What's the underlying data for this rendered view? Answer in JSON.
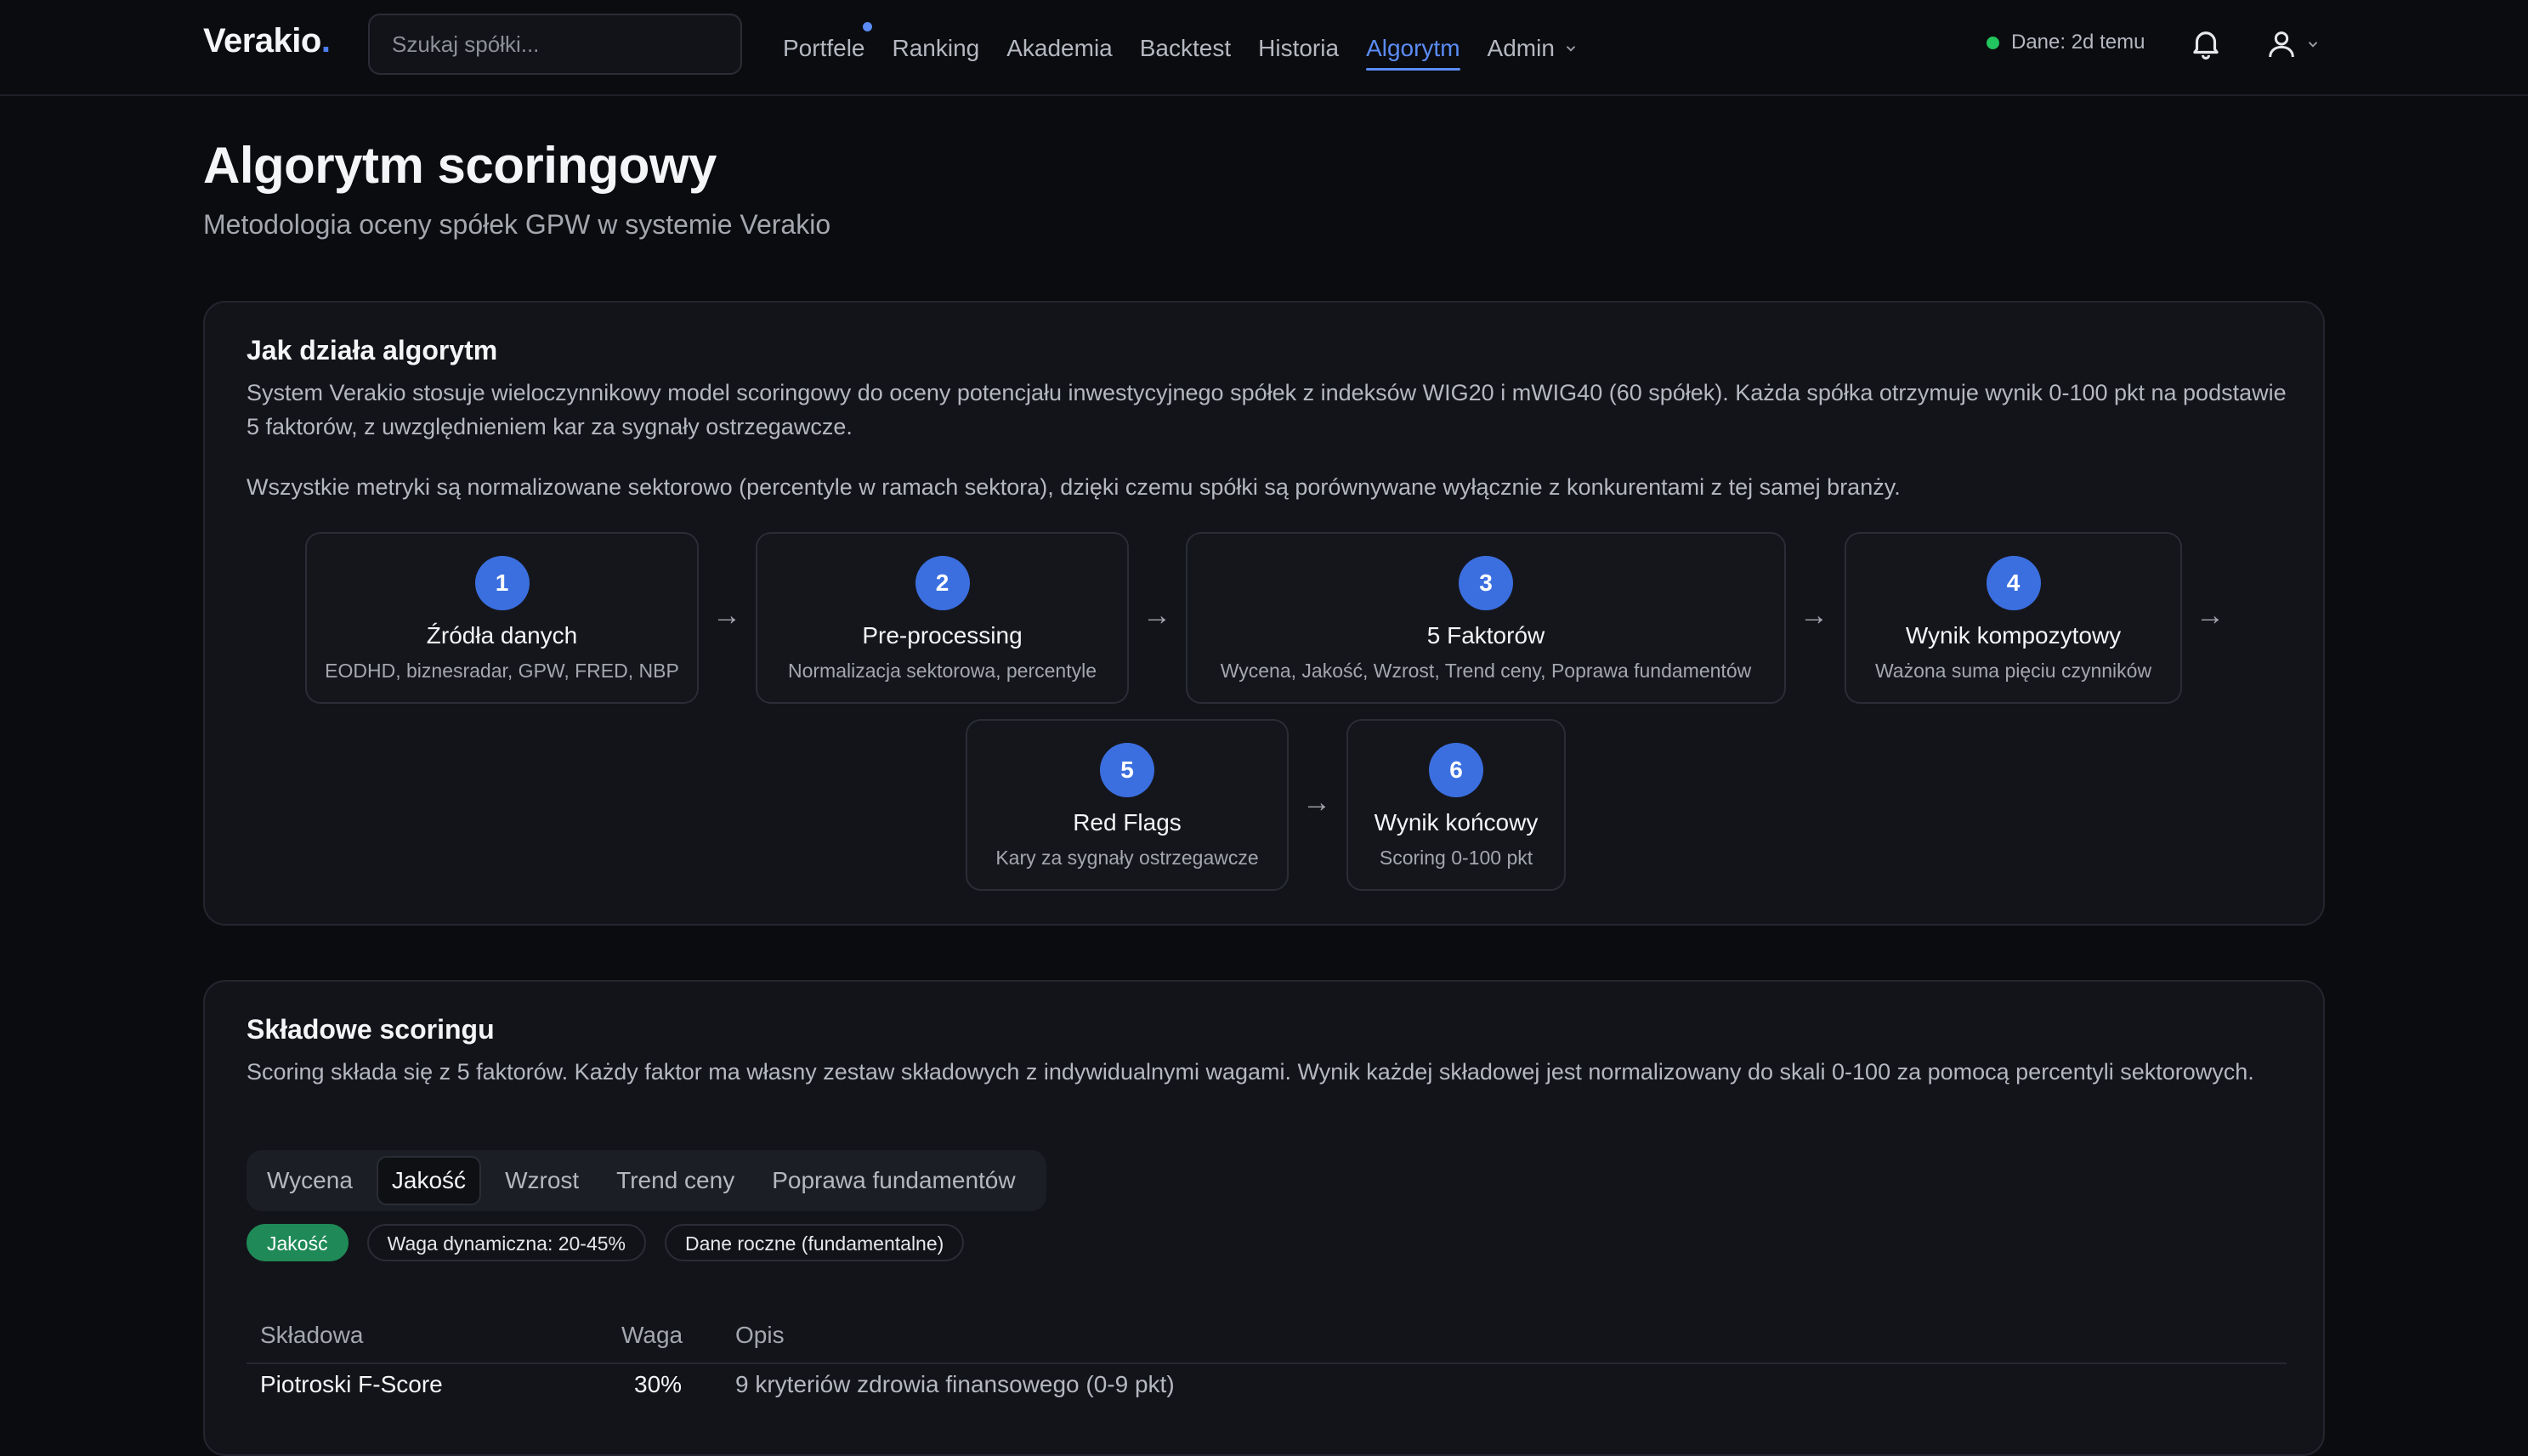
{
  "nav": {
    "logo": "Verakio",
    "logo_dot": ".",
    "search_placeholder": "Szukaj spółki...",
    "links": [
      "Portfele",
      "Ranking",
      "Akademia",
      "Backtest",
      "Historia",
      "Algorytm",
      "Admin"
    ],
    "active_link": "Algorytm",
    "status": "Dane: 2d temu"
  },
  "header": {
    "title": "Algorytm scoringowy",
    "subtitle": "Metodologia oceny spółek GPW w systemie Verakio"
  },
  "how": {
    "title": "Jak działa algorytm",
    "p1": "System Verakio stosuje wieloczynnikowy model scoringowy do oceny potencjału inwestycyjnego spółek z indeksów WIG20 i mWIG40 (60 spółek). Każda spółka otrzymuje wynik 0-100 pkt na podstawie 5 faktorów, z uwzględnieniem kar za sygnały ostrzegawcze.",
    "p2": "Wszystkie metryki są normalizowane sektorowo (percentyle w ramach sektora), dzięki czemu spółki są porównywane wyłącznie z konkurentami z tej samej branży.",
    "steps": [
      {
        "num": "1",
        "title": "Źródła danych",
        "desc": "EODHD, biznesradar, GPW, FRED, NBP"
      },
      {
        "num": "2",
        "title": "Pre-processing",
        "desc": "Normalizacja sektorowa, percentyle"
      },
      {
        "num": "3",
        "title": "5 Faktorów",
        "desc": "Wycena, Jakość, Wzrost, Trend ceny, Poprawa fundamentów"
      },
      {
        "num": "4",
        "title": "Wynik kompozytowy",
        "desc": "Ważona suma pięciu czynników"
      },
      {
        "num": "5",
        "title": "Red Flags",
        "desc": "Kary za sygnały ostrzegawcze"
      },
      {
        "num": "6",
        "title": "Wynik końcowy",
        "desc": "Scoring 0-100 pkt"
      }
    ],
    "arrow": "→"
  },
  "components": {
    "title": "Składowe scoringu",
    "desc": "Scoring składa się z 5 faktorów. Każdy faktor ma własny zestaw składowych z indywidualnymi wagami. Wynik każdej składowej jest normalizowany do skali 0-100 za pomocą percentyli sektorowych.",
    "tabs": [
      "Wycena",
      "Jakość",
      "Wzrost",
      "Trend ceny",
      "Poprawa fundamentów"
    ],
    "active_tab": "Jakość",
    "badges": [
      "Jakość",
      "Waga dynamiczna: 20-45%",
      "Dane roczne (fundamentalne)"
    ],
    "table": {
      "headers": [
        "Składowa",
        "Waga",
        "Opis"
      ],
      "rows": [
        {
          "name": "Piotroski F-Score",
          "weight": "30%",
          "desc": "9 kryteriów zdrowia finansowego (0-9 pkt)"
        }
      ]
    }
  },
  "colors": {
    "accent": "#3b6fe0",
    "active_link": "#5b8cf5",
    "status_green": "#22c55e",
    "badge_green": "#1f8a57"
  }
}
